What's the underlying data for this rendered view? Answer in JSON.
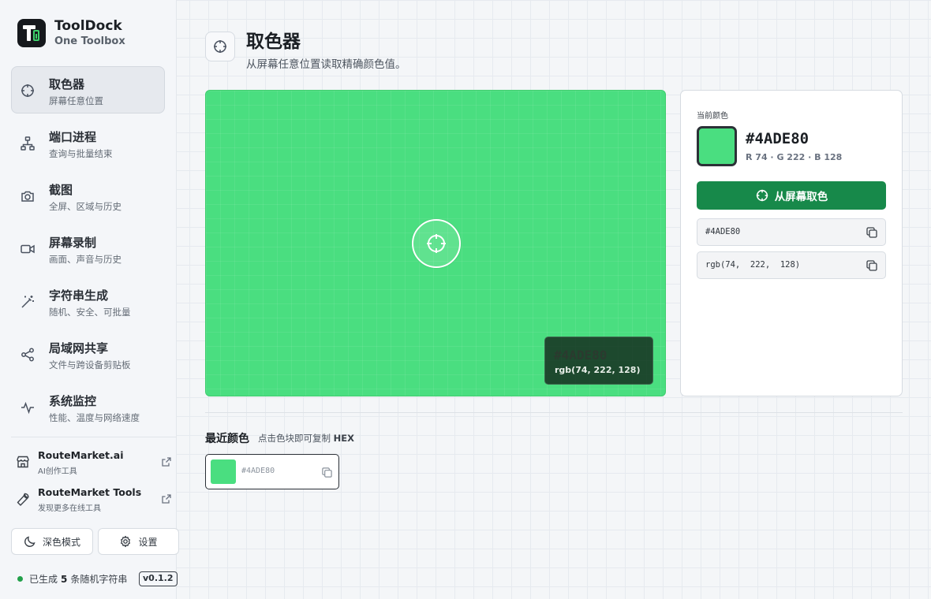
{
  "brand": {
    "name": "ToolDock",
    "subtitle": "One Toolbox"
  },
  "nav": [
    {
      "label": "取色器",
      "desc": "屏幕任意位置",
      "icon": "crosshair-icon",
      "active": true
    },
    {
      "label": "端口进程",
      "desc": "查询与批量结束",
      "icon": "network-icon",
      "active": false
    },
    {
      "label": "截图",
      "desc": "全屏、区域与历史",
      "icon": "camera-icon",
      "active": false
    },
    {
      "label": "屏幕录制",
      "desc": "画面、声音与历史",
      "icon": "video-icon",
      "active": false
    },
    {
      "label": "字符串生成",
      "desc": "随机、安全、可批量",
      "icon": "magic-wand-icon",
      "active": false
    },
    {
      "label": "局域网共享",
      "desc": "文件与跨设备剪贴板",
      "icon": "share-icon",
      "active": false
    },
    {
      "label": "系统监控",
      "desc": "性能、温度与网络速度",
      "icon": "activity-icon",
      "active": false
    }
  ],
  "links": [
    {
      "title": "RouteMarket.ai",
      "desc": "AI创作工具",
      "icon": "store-icon"
    },
    {
      "title": "RouteMarket Tools",
      "desc": "发现更多在线工具",
      "icon": "wrench-icon"
    }
  ],
  "footer": {
    "dark_mode": "深色模式",
    "settings": "设置",
    "status_prefix": "已生成",
    "status_count": "5",
    "status_suffix": "条随机字符串",
    "version": "v0.1.2"
  },
  "page": {
    "title": "取色器",
    "subtitle": "从屏幕任意位置读取精确颜色值。"
  },
  "color": {
    "hex": "#4ADE80",
    "rgb_text": "rgb(74, 222, 128)",
    "rgb_spaced": "rgb(74,  222,  128)",
    "channels": "R 74 · G 222 · B 128",
    "accent": "#17894a"
  },
  "panel": {
    "caption": "当前颜色",
    "pick_button": "从屏幕取色"
  },
  "recent": {
    "title": "最近颜色",
    "hint_prefix": "点击色块即可复制",
    "hint_bold": "HEX",
    "items": [
      {
        "hex": "#4ADE80"
      }
    ]
  }
}
